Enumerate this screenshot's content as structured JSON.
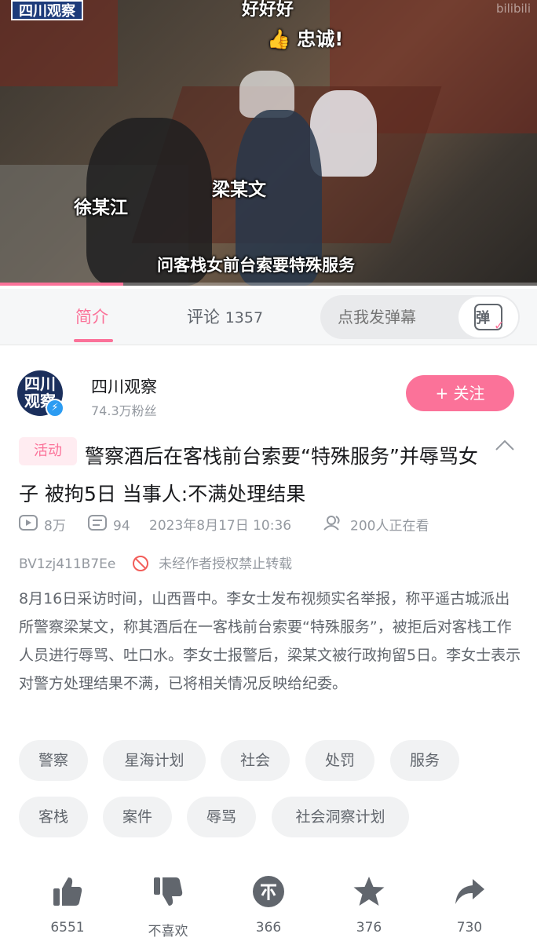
{
  "video": {
    "channel_watermark": "四川观察",
    "caption_top": "好好好",
    "caption_like": "忠诚!",
    "name_label_1": "徐某江",
    "name_label_2": "梁某文",
    "subtitle": "问客栈女前台索要特殊服务",
    "brand_mark": "bilibili",
    "progress_fraction": 0.23
  },
  "tabs": {
    "intro_label": "简介",
    "comments_label": "评论",
    "comments_count": "1357",
    "danmaku_placeholder": "点我发弹幕",
    "danmaku_button_glyph": "弹"
  },
  "uploader": {
    "avatar_text_line1": "四川",
    "avatar_text_line2": "观察",
    "name": "四川观察",
    "fans": "74.3万粉丝",
    "follow_label": "+ 关注"
  },
  "video_info": {
    "badge": "活动",
    "title": "警察酒后在客栈前台索要“特殊服务”并辱骂女子 被拘5日 当事人:不满处理结果",
    "plays": "8万",
    "danmaku_count": "94",
    "publish_time": "2023年8月17日 10:36",
    "watching": "200人正在看",
    "bvid": "BV1zj411B7Ee",
    "no_repost": "未经作者授权禁止转载",
    "description": "8月16日采访时间，山西晋中。李女士发布视频实名举报，称平遥古城派出所警察梁某文，称其酒后在一客栈前台索要“特殊服务”，被拒后对客栈工作人员进行辱骂、吐口水。李女士报警后，梁某文被行政拘留5日。李女士表示对警方处理结果不满，已将相关情况反映给纪委。"
  },
  "tags": [
    "警察",
    "星海计划",
    "社会",
    "处罚",
    "服务",
    "客栈",
    "案件",
    "辱骂",
    "社会洞察计划"
  ],
  "actions": {
    "like": "6551",
    "dislike": "不喜欢",
    "coin": "366",
    "favorite": "376",
    "share": "730"
  },
  "colors": {
    "accent": "#fb7299",
    "text_primary": "#18191c",
    "text_secondary": "#61666d",
    "text_muted": "#9499a0",
    "tag_bg": "#f1f2f3"
  }
}
